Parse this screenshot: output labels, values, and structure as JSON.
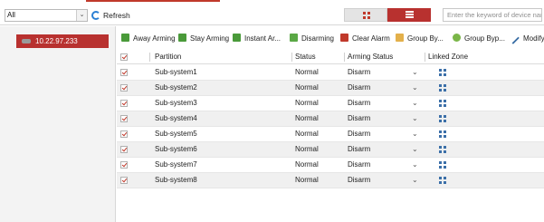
{
  "topbar": {
    "filter_value": "All",
    "refresh_label": "Refresh",
    "search_placeholder": "Enter the keyword of device nam...",
    "accent_color": "#b8312f"
  },
  "device_list": [
    {
      "label": "10.22.97.233",
      "selected": true
    }
  ],
  "toolbar": {
    "buttons": [
      {
        "label": "Away Arming",
        "icon": "away-arming-icon"
      },
      {
        "label": "Stay Arming",
        "icon": "stay-arming-icon"
      },
      {
        "label": "Instant Ar...",
        "icon": "instant-arming-icon"
      },
      {
        "label": "Disarming",
        "icon": "disarming-icon"
      },
      {
        "label": "Clear Alarm",
        "icon": "clear-alarm-icon"
      },
      {
        "label": "Group By...",
        "icon": "group-bypass-icon"
      },
      {
        "label": "Group Byp...",
        "icon": "group-bypass-recover-icon"
      },
      {
        "label": "Modify",
        "icon": "pencil-icon"
      }
    ]
  },
  "table": {
    "columns": [
      "Partition",
      "Status",
      "Arming Status",
      "Linked Zone"
    ],
    "rows": [
      {
        "partition": "Sub-system1",
        "status": "Normal",
        "arming": "Disarm",
        "checked": true
      },
      {
        "partition": "Sub-system2",
        "status": "Normal",
        "arming": "Disarm",
        "checked": true
      },
      {
        "partition": "Sub-system3",
        "status": "Normal",
        "arming": "Disarm",
        "checked": true
      },
      {
        "partition": "Sub-system4",
        "status": "Normal",
        "arming": "Disarm",
        "checked": true
      },
      {
        "partition": "Sub-system5",
        "status": "Normal",
        "arming": "Disarm",
        "checked": true
      },
      {
        "partition": "Sub-system6",
        "status": "Normal",
        "arming": "Disarm",
        "checked": true
      },
      {
        "partition": "Sub-system7",
        "status": "Normal",
        "arming": "Disarm",
        "checked": true
      },
      {
        "partition": "Sub-system8",
        "status": "Normal",
        "arming": "Disarm",
        "checked": true
      }
    ]
  }
}
